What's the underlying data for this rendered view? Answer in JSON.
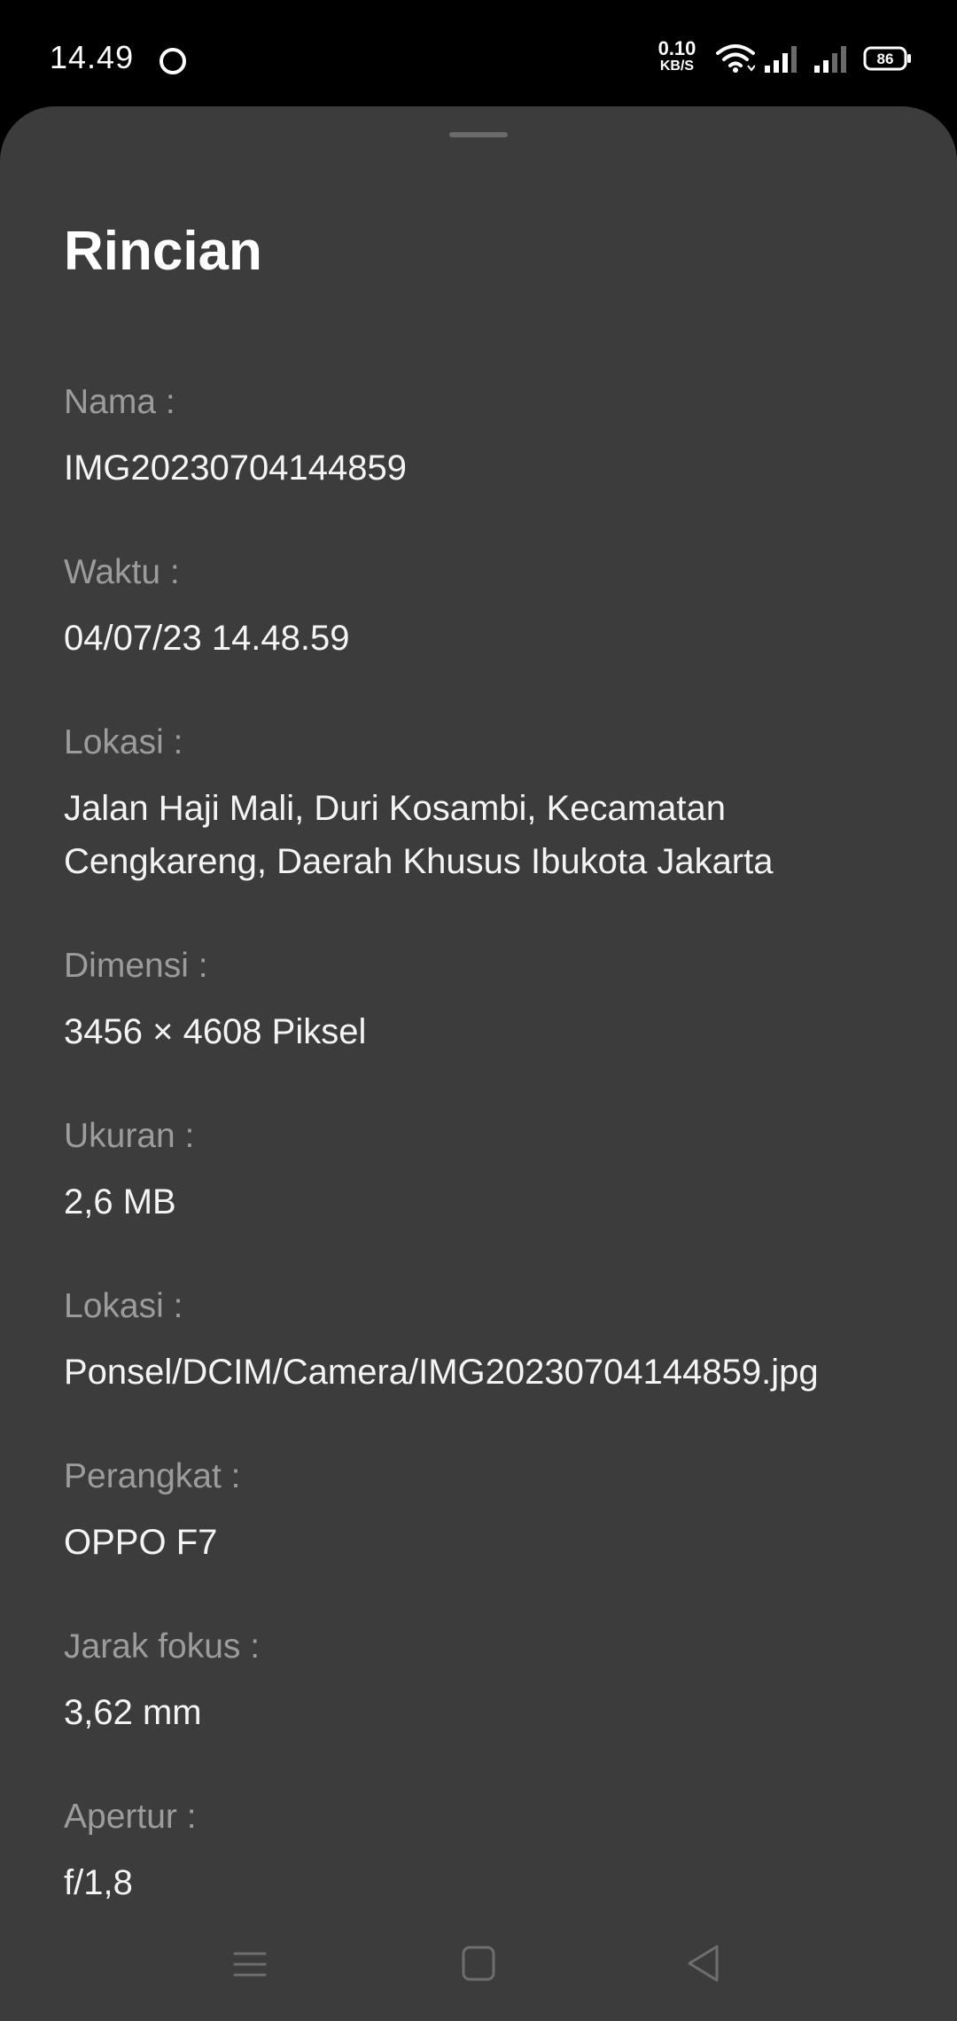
{
  "status_bar": {
    "time": "14.49",
    "net_speed_value": "0.10",
    "net_speed_unit": "KB/S",
    "battery_level": "86"
  },
  "sheet": {
    "title": "Rincian",
    "fields": [
      {
        "label": "Nama :",
        "value": "IMG20230704144859"
      },
      {
        "label": "Waktu :",
        "value": "04/07/23 14.48.59"
      },
      {
        "label": "Lokasi :",
        "value_line1": "Jalan Haji Mali, Duri Kosambi, Kecamatan",
        "value_line2": "Cengkareng, Daerah Khusus Ibukota Jakarta"
      },
      {
        "label": "Dimensi :",
        "value": "3456 × 4608 Piksel"
      },
      {
        "label": "Ukuran :",
        "value": "2,6 MB"
      },
      {
        "label": "Lokasi :",
        "value": "Ponsel/DCIM/Camera/IMG20230704144859.jpg"
      },
      {
        "label": "Perangkat :",
        "value": "OPPO F7"
      },
      {
        "label": "Jarak fokus :",
        "value": "3,62 mm"
      },
      {
        "label": "Apertur :",
        "value": "f/1,8"
      }
    ]
  },
  "icons": {
    "status": [
      "notification-circle-icon",
      "wifi-icon",
      "signal-icon",
      "signal-icon",
      "battery-icon"
    ],
    "nav": [
      "menu-icon",
      "home-icon",
      "back-icon"
    ]
  },
  "colors": {
    "background": "#000000",
    "sheet": "#3c3c3c",
    "label": "#9c9c9c",
    "value": "#f4f4f4"
  }
}
